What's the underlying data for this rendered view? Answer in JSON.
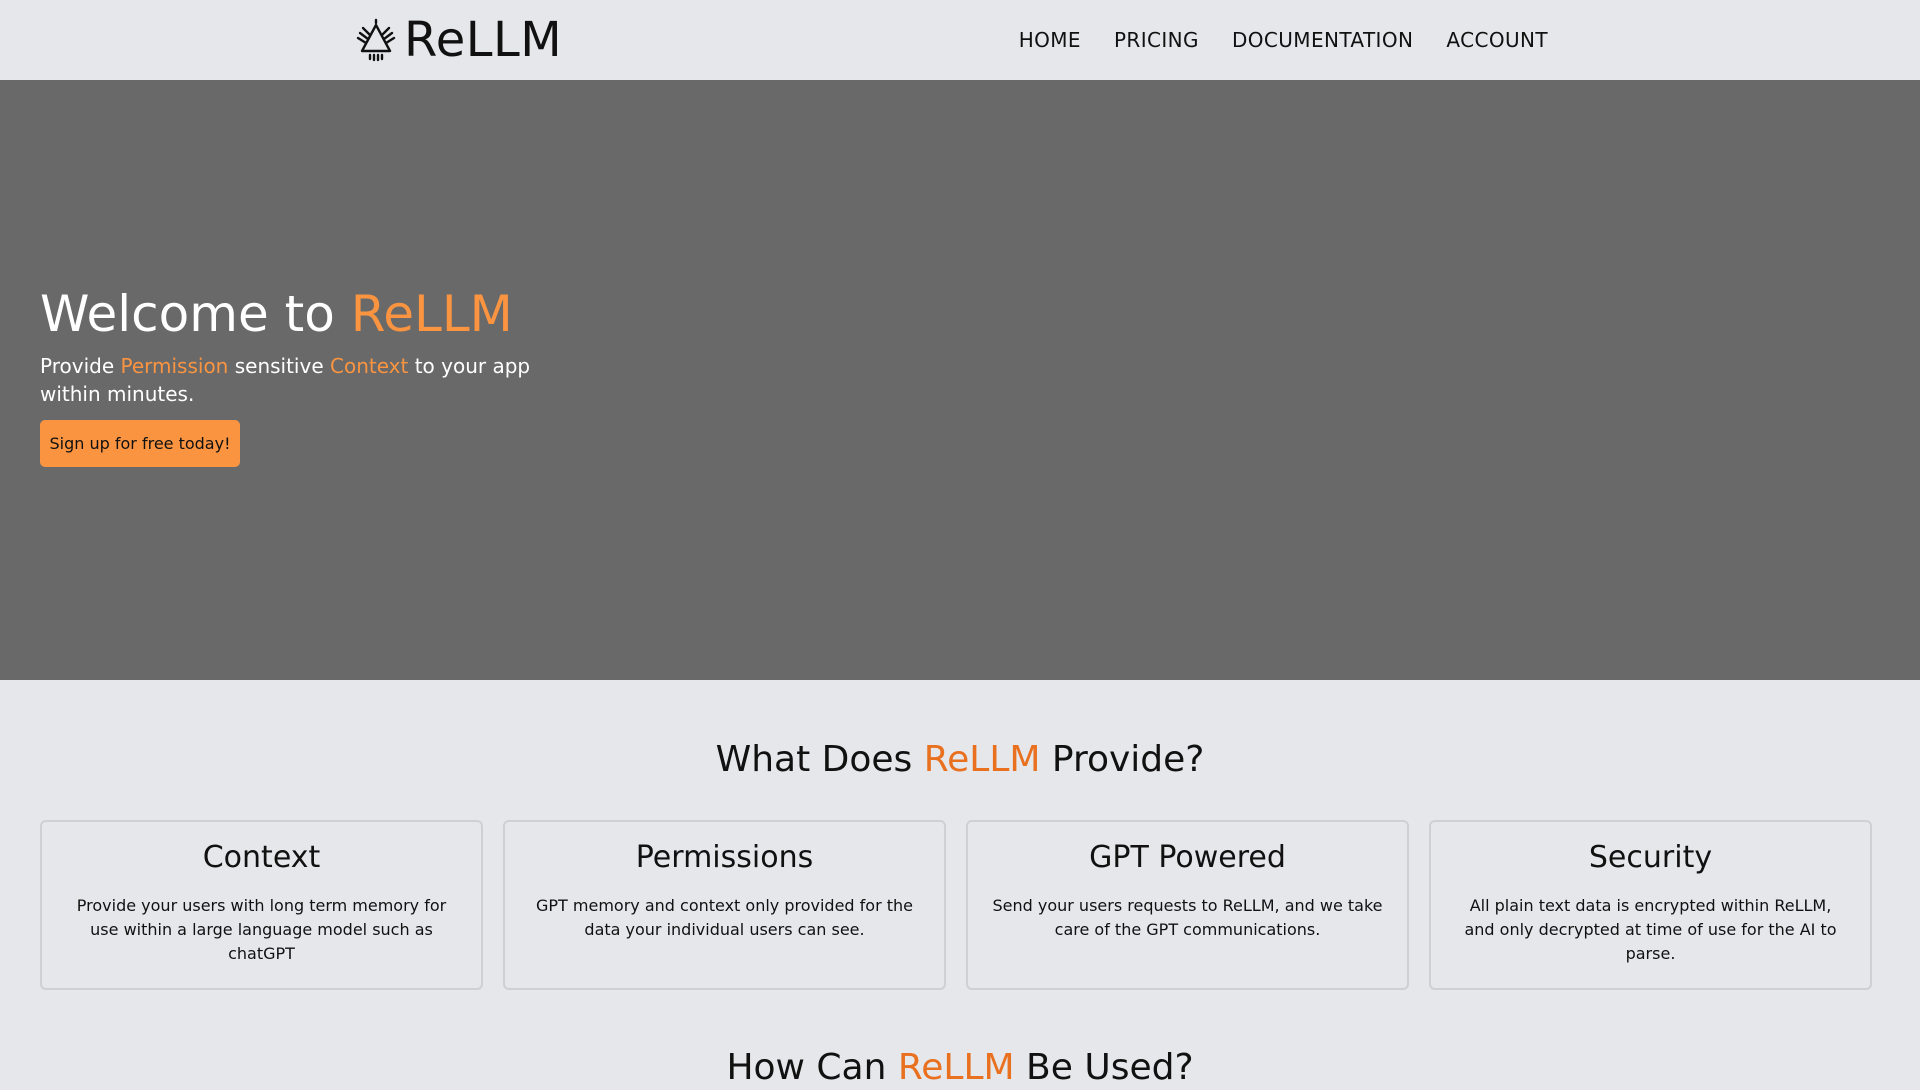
{
  "header": {
    "logo_text": "ReLLM",
    "nav": [
      {
        "label": "HOME"
      },
      {
        "label": "PRICING"
      },
      {
        "label": "DOCUMENTATION"
      },
      {
        "label": "ACCOUNT"
      }
    ]
  },
  "hero": {
    "title_prefix": "Welcome to ",
    "title_accent": "ReLLM",
    "subtitle_parts": {
      "p1": "Provide ",
      "accent1": "Permission",
      "p2": " sensitive ",
      "accent2": "Context",
      "p3": " to your app within minutes."
    },
    "cta_label": "Sign up for free today!"
  },
  "features": {
    "title_prefix": "What Does ",
    "title_accent": "ReLLM",
    "title_suffix": " Provide?",
    "cards": [
      {
        "title": "Context",
        "description": "Provide your users with long term memory for use within a large language model such as chatGPT"
      },
      {
        "title": "Permissions",
        "description": "GPT memory and context only provided for the data your individual users can see."
      },
      {
        "title": "GPT Powered",
        "description": "Send your users requests to ReLLM, and we take care of the GPT communications."
      },
      {
        "title": "Security",
        "description": "All plain text data is encrypted within ReLLM, and only decrypted at time of use for the AI to parse."
      }
    ]
  },
  "usage": {
    "title_prefix": "How Can ",
    "title_accent": "ReLLM",
    "title_suffix": " Be Used?"
  },
  "colors": {
    "page_background": "#e6e7eb",
    "hero_background": "#696969",
    "accent_orange": "#fa9440",
    "accent_orange_dark": "#e8701f",
    "card_border": "#cfd0d4",
    "text": "#111111"
  },
  "icons": {
    "logo": "rellm-logo-icon"
  }
}
